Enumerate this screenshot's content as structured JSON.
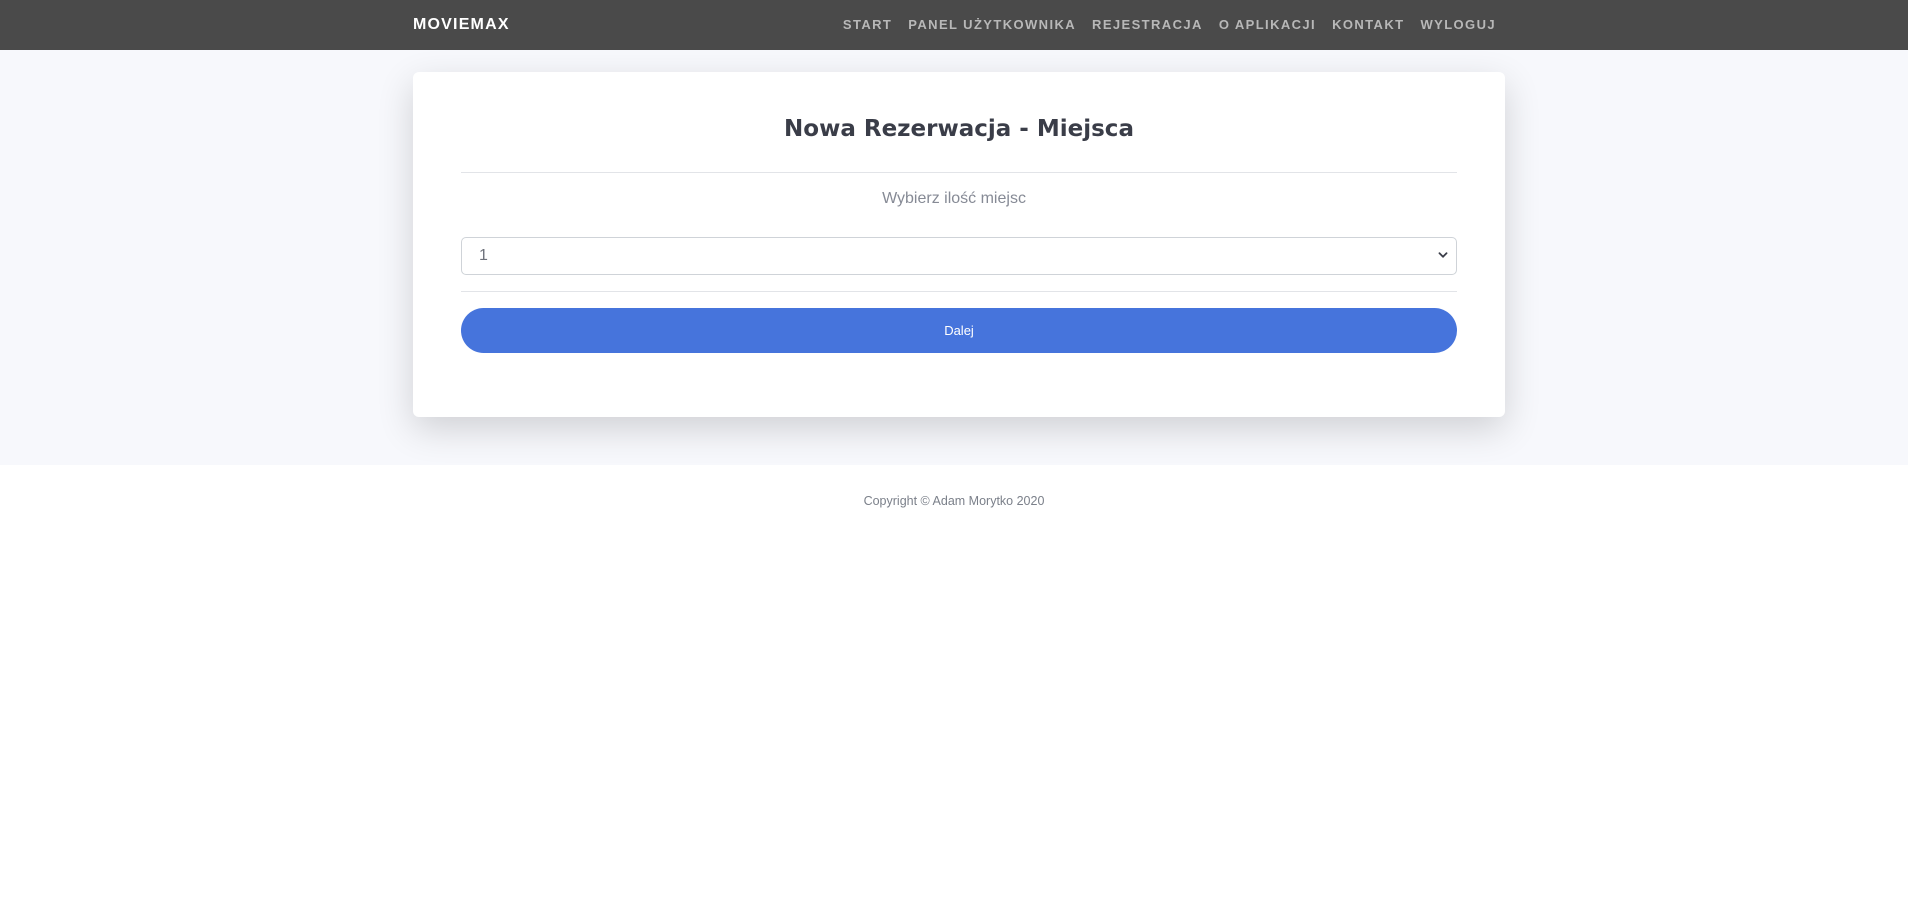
{
  "navbar": {
    "brand": "MOVIEMAX",
    "links": [
      {
        "label": "START"
      },
      {
        "label": "PANEL UŻYTKOWNIKA"
      },
      {
        "label": "REJESTRACJA"
      },
      {
        "label": "O APLIKACJI"
      },
      {
        "label": "KONTAKT"
      },
      {
        "label": "WYLOGUJ"
      }
    ]
  },
  "card": {
    "title": "Nowa Rezerwacja - Miejsca",
    "subtitle": "Wybierz ilość miejsc",
    "select": {
      "value": "1",
      "icon": "chevron-down-icon"
    },
    "button_label": "Dalej"
  },
  "footer": {
    "text": "Copyright © Adam Morytko 2020"
  },
  "colors": {
    "navbar": "#4a4a4a",
    "accent": "#4674dc",
    "background": "#f7f8fc"
  }
}
